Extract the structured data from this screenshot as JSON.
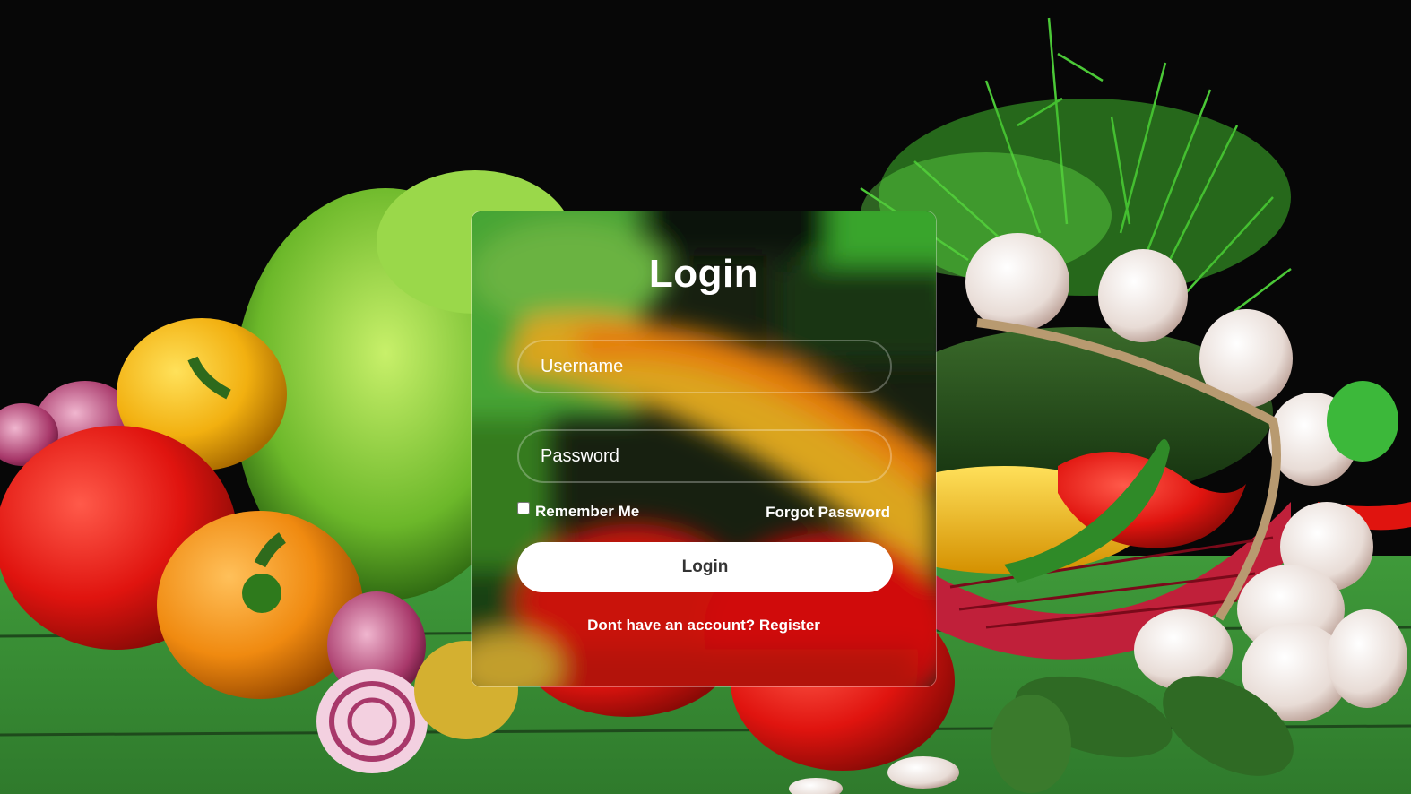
{
  "login_form": {
    "title": "Login",
    "username_placeholder": "Username",
    "password_placeholder": "Password",
    "remember_label": "Remember Me",
    "forgot_link": "Forgot Password",
    "submit_label": "Login",
    "register_prompt": "Dont have an account?",
    "register_link": "Register"
  }
}
